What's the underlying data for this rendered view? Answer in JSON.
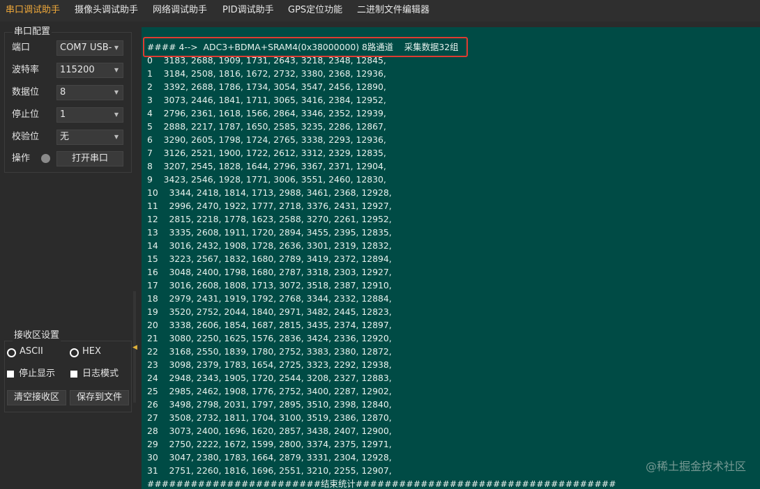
{
  "tabs": [
    {
      "label": "串口调试助手",
      "active": true
    },
    {
      "label": "摄像头调试助手",
      "active": false
    },
    {
      "label": "网络调试助手",
      "active": false
    },
    {
      "label": "PID调试助手",
      "active": false
    },
    {
      "label": "GPS定位功能",
      "active": false
    },
    {
      "label": "二进制文件编辑器",
      "active": false
    }
  ],
  "serial_config": {
    "title": "串口配置",
    "port": {
      "label": "端口",
      "value": "COM7 USB-"
    },
    "baud": {
      "label": "波特率",
      "value": "115200"
    },
    "databits": {
      "label": "数据位",
      "value": "8"
    },
    "stopbits": {
      "label": "停止位",
      "value": "1"
    },
    "parity": {
      "label": "校验位",
      "value": "无"
    },
    "operation": {
      "label": "操作",
      "open_button": "打开串口"
    }
  },
  "receive_settings": {
    "title": "接收区设置",
    "ascii_label": "ASCII",
    "hex_label": "HEX",
    "stop_display_label": "停止显示",
    "log_mode_label": "日志模式",
    "clear_button": "清空接收区",
    "save_button": "保存到文件",
    "selected_mode": "ASCII"
  },
  "terminal": {
    "header": "#### 4-->  ADC3+BDMA+SRAM4(0x38000000) 8路通道    采集数据32组",
    "lines": [
      "0    3183, 2688, 1909, 1731, 2643, 3218, 2348, 12845,",
      "1    3184, 2508, 1816, 1672, 2732, 3380, 2368, 12936,",
      "2    3392, 2688, 1786, 1734, 3054, 3547, 2456, 12890,",
      "3    3073, 2446, 1841, 1711, 3065, 3416, 2384, 12952,",
      "4    2796, 2361, 1618, 1566, 2864, 3346, 2352, 12939,",
      "5    2888, 2217, 1787, 1650, 2585, 3235, 2286, 12867,",
      "6    3290, 2605, 1798, 1724, 2765, 3338, 2293, 12936,",
      "7    3126, 2521, 1900, 1722, 2612, 3312, 2329, 12835,",
      "8    3207, 2545, 1828, 1644, 2796, 3367, 2371, 12904,",
      "9    3423, 2546, 1928, 1771, 3006, 3551, 2460, 12830,",
      "10    3344, 2418, 1814, 1713, 2988, 3461, 2368, 12928,",
      "11    2996, 2470, 1922, 1777, 2718, 3376, 2431, 12927,",
      "12    2815, 2218, 1778, 1623, 2588, 3270, 2261, 12952,",
      "13    3335, 2608, 1911, 1720, 2894, 3455, 2395, 12835,",
      "14    3016, 2432, 1908, 1728, 2636, 3301, 2319, 12832,",
      "15    3223, 2567, 1832, 1680, 2789, 3419, 2372, 12894,",
      "16    3048, 2400, 1798, 1680, 2787, 3318, 2303, 12927,",
      "17    3016, 2608, 1808, 1713, 3072, 3518, 2387, 12910,",
      "18    2979, 2431, 1919, 1792, 2768, 3344, 2332, 12884,",
      "19    3520, 2752, 2044, 1840, 2971, 3482, 2445, 12823,",
      "20    3338, 2606, 1854, 1687, 2815, 3435, 2374, 12897,",
      "21    3080, 2250, 1625, 1576, 2836, 3424, 2336, 12920,",
      "22    3168, 2550, 1839, 1780, 2752, 3383, 2380, 12872,",
      "23    3098, 2379, 1783, 1654, 2725, 3323, 2292, 12938,",
      "24    2948, 2343, 1905, 1720, 2544, 3208, 2327, 12883,",
      "25    2985, 2462, 1908, 1776, 2752, 3400, 2287, 12902,",
      "26    3498, 2798, 2031, 1797, 2895, 3510, 2398, 12840,",
      "27    3508, 2732, 1811, 1704, 3100, 3519, 2386, 12870,",
      "28    3073, 2400, 1696, 1620, 2857, 3438, 2407, 12900,",
      "29    2750, 2222, 1672, 1599, 2800, 3374, 2375, 12971,",
      "30    3047, 2380, 1783, 1664, 2879, 3331, 2304, 12928,",
      "31    2751, 2260, 1816, 1696, 2551, 3210, 2255, 12907,"
    ],
    "footer": "########################结束统计####################################"
  },
  "watermark": "@稀土掘金技术社区",
  "colors": {
    "accent_active_tab": "#f0a93a",
    "terminal_bg": "#004b45",
    "highlight_border": "#e03c31",
    "app_bg": "#2b2b2b"
  }
}
